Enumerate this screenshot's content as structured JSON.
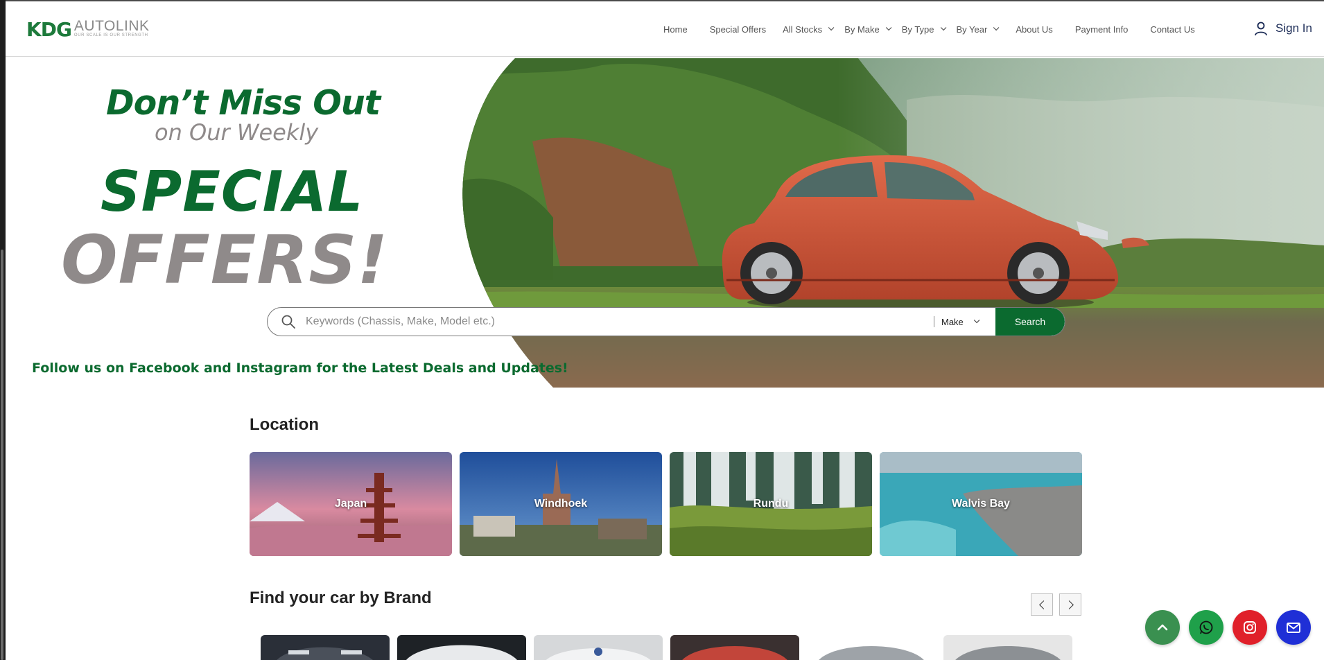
{
  "header": {
    "logo": {
      "mark": "KDG",
      "name": "AUTOLINK",
      "tagline": "OUR SCALE IS OUR STRENGTH"
    },
    "nav": [
      {
        "label": "Home",
        "dropdown": false
      },
      {
        "label": "Special Offers",
        "dropdown": false
      },
      {
        "label": "All Stocks",
        "dropdown": true
      },
      {
        "label": "By Make",
        "dropdown": true
      },
      {
        "label": "By Type",
        "dropdown": true
      },
      {
        "label": "By Year",
        "dropdown": true
      },
      {
        "label": "About Us",
        "dropdown": false
      },
      {
        "label": "Payment Info",
        "dropdown": false
      },
      {
        "label": "Contact Us",
        "dropdown": false
      }
    ],
    "signin_label": "Sign In"
  },
  "hero": {
    "line1": "Don’t Miss Out",
    "line2": "on Our Weekly",
    "line3": "SPECIAL",
    "line4": "OFFERS!",
    "follow": "Follow us on Facebook and Instagram for the Latest Deals and Updates!"
  },
  "search": {
    "placeholder": "Keywords (Chassis, Make, Model etc.)",
    "value": "",
    "make_selected": "Make",
    "button_label": "Search"
  },
  "location": {
    "title": "Location",
    "items": [
      "Japan",
      "Windhoek",
      "Rundu",
      "Walvis Bay"
    ]
  },
  "brands": {
    "title": "Find your car by Brand",
    "card_count": 6
  },
  "fabs": [
    "scroll-top",
    "whatsapp",
    "instagram",
    "email"
  ],
  "colors": {
    "brand_green": "#0b6a2f",
    "promo_grey": "#8f8a8a",
    "nav_text": "#555555",
    "whatsapp": "#1fa04a",
    "instagram": "#e0202a",
    "email": "#1f2fd6",
    "scroll_top": "#3a9050"
  }
}
